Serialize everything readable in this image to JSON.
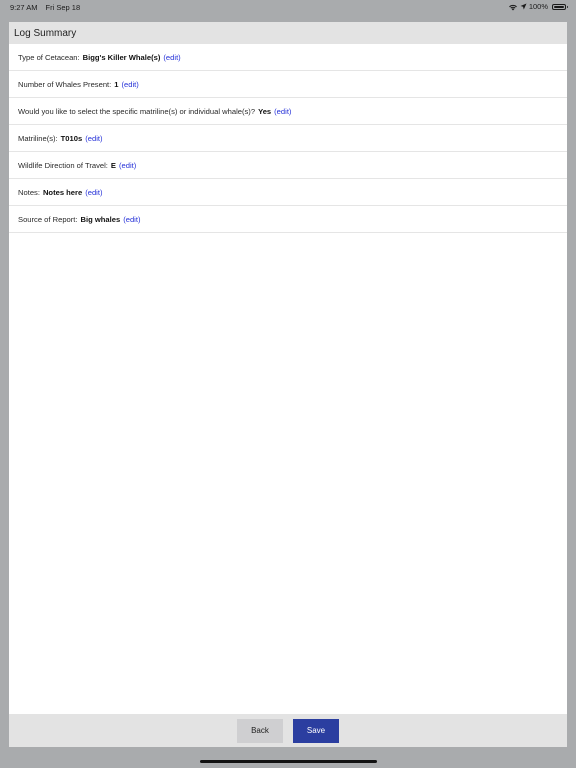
{
  "status_bar": {
    "time": "9:27 AM",
    "date": "Fri Sep 18",
    "battery": "100%",
    "battery_level": 1.0,
    "icons": [
      "wifi-icon",
      "location-arrow-icon",
      "battery-icon"
    ]
  },
  "header": {
    "title": "Log Summary"
  },
  "rows": [
    {
      "label": "Type of Cetacean:",
      "value": "Bigg's Killer Whale(s)",
      "edit": "(edit)"
    },
    {
      "label": "Number of Whales Present:",
      "value": "1",
      "edit": "(edit)"
    },
    {
      "label": "Would you like to select the specific matriline(s) or individual whale(s)?",
      "value": "Yes",
      "edit": "(edit)"
    },
    {
      "label": "Matriline(s):",
      "value": "T010s",
      "edit": "(edit)"
    },
    {
      "label": "Wildlife Direction of Travel:",
      "value": "E",
      "edit": "(edit)"
    },
    {
      "label": "Notes:",
      "value": "Notes here",
      "edit": "(edit)"
    },
    {
      "label": "Source of Report:",
      "value": "Big whales",
      "edit": "(edit)"
    }
  ],
  "footer": {
    "back_label": "Back",
    "save_label": "Save"
  },
  "colors": {
    "accent": "#2b3ea0",
    "link": "#2430d8",
    "header_bg": "#e3e3e3",
    "backdrop": "#a9abad"
  }
}
